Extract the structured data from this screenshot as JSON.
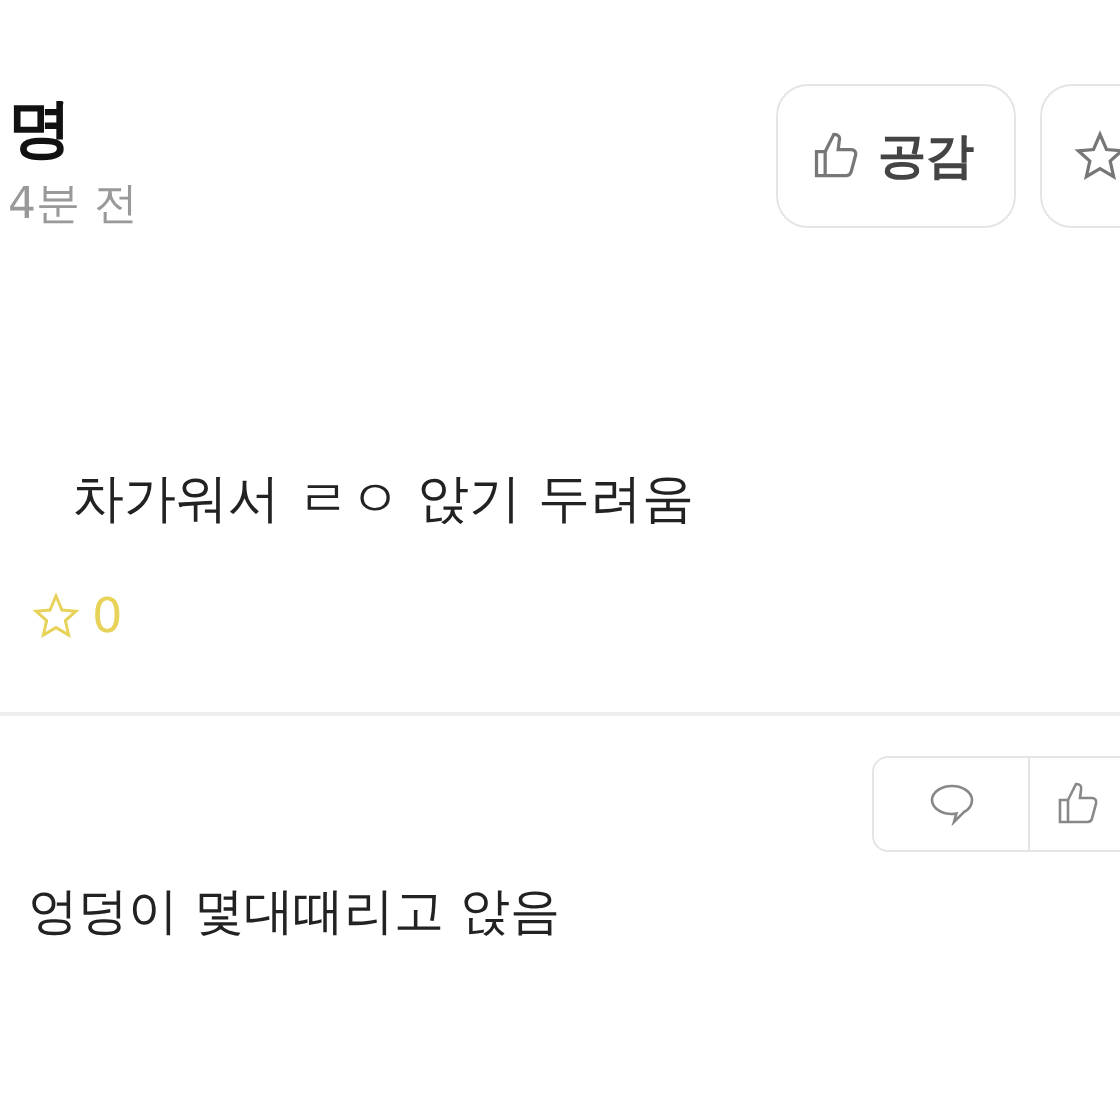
{
  "post": {
    "author": "명",
    "time": "4분 전",
    "body": "차가워서 ㄹㅇ 앉기 두려움",
    "star_count": "0",
    "like_button": "공감"
  },
  "comment": {
    "body": "엉덩이 몇대때리고 앉음"
  }
}
